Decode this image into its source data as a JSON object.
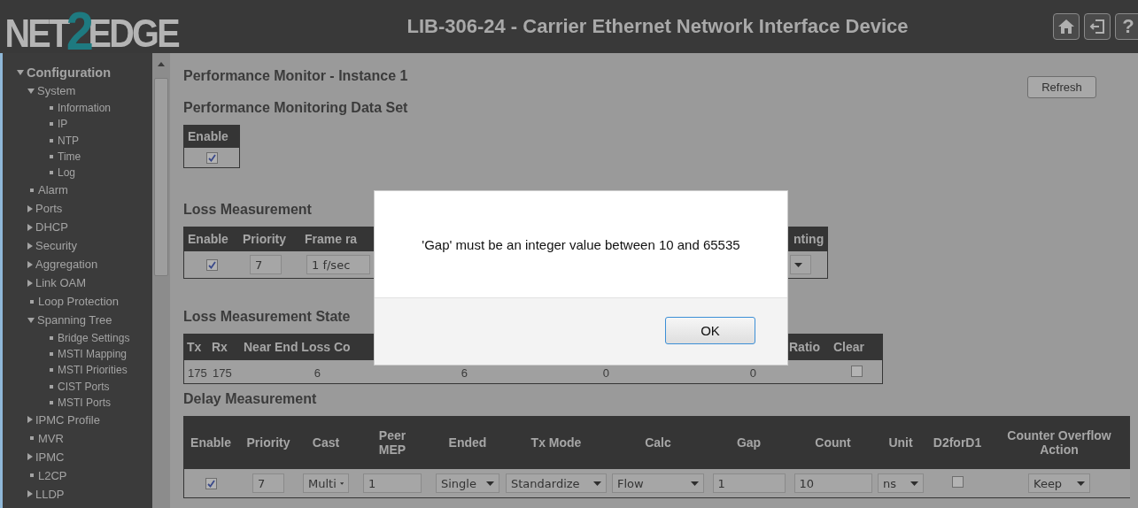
{
  "header": {
    "logo": {
      "part_1": "NET",
      "part_2": "2",
      "part_3": "EDGE"
    },
    "title": "LIB-306-24 - Carrier Ethernet Network Interface Device",
    "help_label": "?"
  },
  "sidebar": {
    "items": [
      {
        "label": "Configuration",
        "kind": "folder",
        "expanded": true,
        "children": [
          {
            "label": "System",
            "kind": "folder",
            "expanded": true,
            "children": [
              {
                "label": "Information",
                "kind": "page"
              },
              {
                "label": "IP",
                "kind": "page"
              },
              {
                "label": "NTP",
                "kind": "page"
              },
              {
                "label": "Time",
                "kind": "page"
              },
              {
                "label": "Log",
                "kind": "page"
              }
            ]
          },
          {
            "label": "Alarm",
            "kind": "page"
          },
          {
            "label": "Ports",
            "kind": "folder",
            "expanded": false
          },
          {
            "label": "DHCP",
            "kind": "folder",
            "expanded": false
          },
          {
            "label": "Security",
            "kind": "folder",
            "expanded": false
          },
          {
            "label": "Aggregation",
            "kind": "folder",
            "expanded": false
          },
          {
            "label": "Link OAM",
            "kind": "folder",
            "expanded": false
          },
          {
            "label": "Loop Protection",
            "kind": "page"
          },
          {
            "label": "Spanning Tree",
            "kind": "folder",
            "expanded": true,
            "children": [
              {
                "label": "Bridge Settings",
                "kind": "page"
              },
              {
                "label": "MSTI Mapping",
                "kind": "page"
              },
              {
                "label": "MSTI Priorities",
                "kind": "page"
              },
              {
                "label": "CIST Ports",
                "kind": "page"
              },
              {
                "label": "MSTI Ports",
                "kind": "page"
              }
            ]
          },
          {
            "label": "IPMC Profile",
            "kind": "folder",
            "expanded": false
          },
          {
            "label": "MVR",
            "kind": "page"
          },
          {
            "label": "IPMC",
            "kind": "folder",
            "expanded": false
          },
          {
            "label": "L2CP",
            "kind": "page"
          },
          {
            "label": "LLDP",
            "kind": "folder",
            "expanded": false
          }
        ]
      }
    ]
  },
  "page": {
    "title": "Performance Monitor - Instance 1",
    "refresh_button": "Refresh",
    "data_set": {
      "heading": "Performance Monitoring Data Set",
      "column": "Enable",
      "enabled": true
    },
    "loss": {
      "heading": "Loss Measurement",
      "columns": [
        "Enable",
        "Priority",
        "Frame ra",
        "nting"
      ],
      "row": {
        "enabled": true,
        "priority": "7",
        "frame_rate": "1 f/sec"
      }
    },
    "loss_state": {
      "heading": "Loss Measurement State",
      "columns": [
        "Tx",
        "Rx",
        "Near End Loss Co",
        "Ratio",
        "Clear"
      ],
      "row": {
        "values": [
          "175",
          "175",
          "6",
          "6",
          "0",
          "0"
        ],
        "clear_checked": false
      }
    },
    "delay": {
      "heading": "Delay Measurement",
      "columns": [
        "Enable",
        "Priority",
        "Cast",
        "Peer\nMEP",
        "Ended",
        "Tx Mode",
        "Calc",
        "Gap",
        "Count",
        "Unit",
        "D2forD1",
        "Counter Overflow\nAction"
      ],
      "row": [
        {
          "kind": "checkbox",
          "checked": true
        },
        {
          "kind": "input",
          "value": "7"
        },
        {
          "kind": "select",
          "value": "Multi"
        },
        {
          "kind": "input",
          "value": "1"
        },
        {
          "kind": "select",
          "value": "Single"
        },
        {
          "kind": "select",
          "value": "Standardize"
        },
        {
          "kind": "select",
          "value": "Flow"
        },
        {
          "kind": "input",
          "value": "1"
        },
        {
          "kind": "input",
          "value": "10"
        },
        {
          "kind": "select",
          "value": "ns"
        },
        {
          "kind": "checkbox",
          "checked": false
        },
        {
          "kind": "select",
          "value": "Keep"
        }
      ]
    }
  },
  "dialog": {
    "message": "'Gap' must be an integer value between 10 and 65535",
    "ok_button": "OK"
  }
}
